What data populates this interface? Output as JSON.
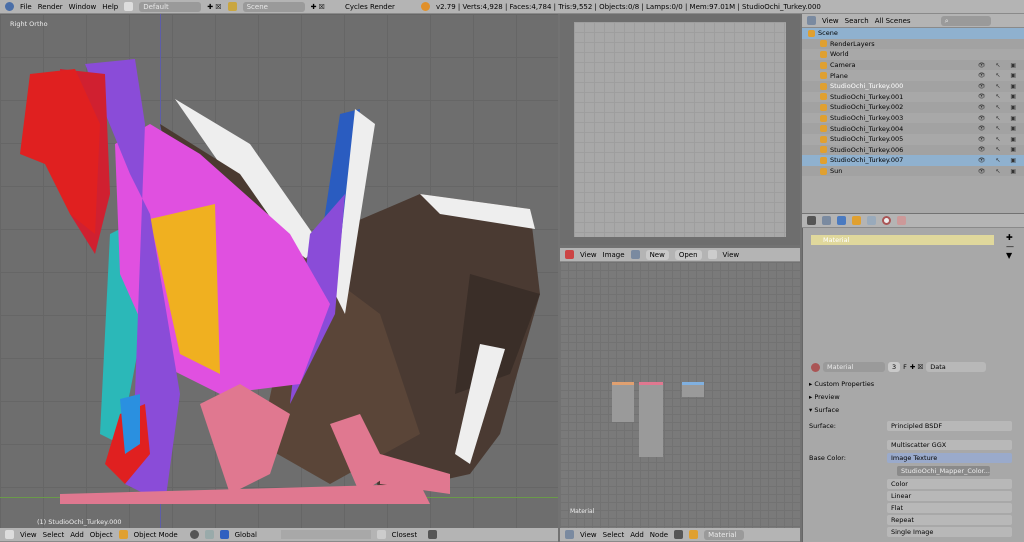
{
  "topbar": {
    "menus": [
      "File",
      "Render",
      "Window",
      "Help"
    ],
    "layout": "Default",
    "scene": "Scene",
    "engine": "Cycles Render",
    "stats": "v2.79 | Verts:4,928 | Faces:4,784 | Tris:9,552 | Objects:0/8 | Lamps:0/0 | Mem:97.01M | StudioOchi_Turkey.000"
  },
  "viewport": {
    "view_label": "Right Ortho",
    "object_label": "(1) StudioOchi_Turkey.000",
    "header": {
      "menus": [
        "View",
        "Select",
        "Add",
        "Object"
      ],
      "mode": "Object Mode",
      "orientation": "Global",
      "snap": "Closest"
    }
  },
  "image_editor": {
    "menus": [
      "View",
      "Image"
    ],
    "new": "New",
    "open": "Open",
    "view": "View"
  },
  "node_editor": {
    "label": "Material",
    "menus": [
      "View",
      "Select",
      "Add",
      "Node"
    ],
    "material": "Material"
  },
  "outliner": {
    "menus": [
      "View",
      "Search"
    ],
    "filter": "All Scenes",
    "items": [
      {
        "name": "Scene",
        "level": 0
      },
      {
        "name": "RenderLayers",
        "level": 1
      },
      {
        "name": "World",
        "level": 1
      },
      {
        "name": "Camera",
        "level": 1
      },
      {
        "name": "Plane",
        "level": 1
      },
      {
        "name": "StudioOchi_Turkey.000",
        "level": 1,
        "active": true
      },
      {
        "name": "StudioOchi_Turkey.001",
        "level": 1
      },
      {
        "name": "StudioOchi_Turkey.002",
        "level": 1
      },
      {
        "name": "StudioOchi_Turkey.003",
        "level": 1
      },
      {
        "name": "StudioOchi_Turkey.004",
        "level": 1
      },
      {
        "name": "StudioOchi_Turkey.005",
        "level": 1
      },
      {
        "name": "StudioOchi_Turkey.006",
        "level": 1
      },
      {
        "name": "StudioOchi_Turkey.007",
        "level": 1,
        "selected": true
      },
      {
        "name": "Sun",
        "level": 1
      }
    ]
  },
  "properties": {
    "slot": "Material",
    "material_name": "Material",
    "users": "3",
    "fake": "F",
    "link": "Data",
    "panels": [
      "Custom Properties",
      "Preview",
      "Surface"
    ],
    "surface_label": "Surface:",
    "surface": "Principled BSDF",
    "distribution": "Multiscatter GGX",
    "base_color_label": "Base Color:",
    "base_color": "Image Texture",
    "image": "StudioOchi_Mapper_Color...",
    "image_f": "F",
    "image_opts": [
      "Color",
      "Linear",
      "Flat",
      "Repeat",
      "Single Image"
    ]
  },
  "colors": {
    "selection": "#8fb1cf",
    "material_slot": "#e0d89c",
    "base_color_field": "#9aaacb"
  }
}
